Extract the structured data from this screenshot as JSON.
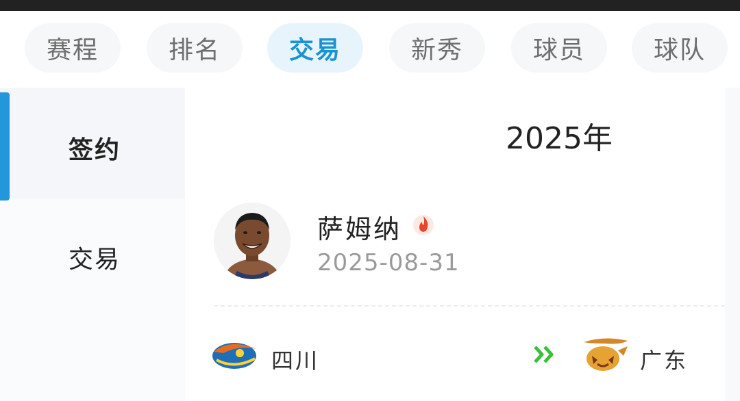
{
  "tabs": [
    {
      "label": "赛程",
      "active": false
    },
    {
      "label": "排名",
      "active": false
    },
    {
      "label": "交易",
      "active": true
    },
    {
      "label": "新秀",
      "active": false
    },
    {
      "label": "球员",
      "active": false
    },
    {
      "label": "球队",
      "active": false
    }
  ],
  "sidebar": {
    "items": [
      {
        "label": "签约",
        "active": true
      },
      {
        "label": "交易",
        "active": false
      }
    ]
  },
  "main": {
    "year": "2025年",
    "transaction": {
      "player_name": "萨姆纳",
      "date": "2025-08-31",
      "hot_icon": "fire-icon",
      "from_team": {
        "name": "四川",
        "logo": "sichuan-team-logo"
      },
      "to_team": {
        "name": "广东",
        "logo": "guangdong-team-logo"
      },
      "direction_icon": "double-chevron-right-icon"
    }
  },
  "colors": {
    "accent": "#1a93d2",
    "active_tab_bg": "#e8f4fb",
    "hot": "#e8452c",
    "arrow": "#3bbf3b"
  }
}
